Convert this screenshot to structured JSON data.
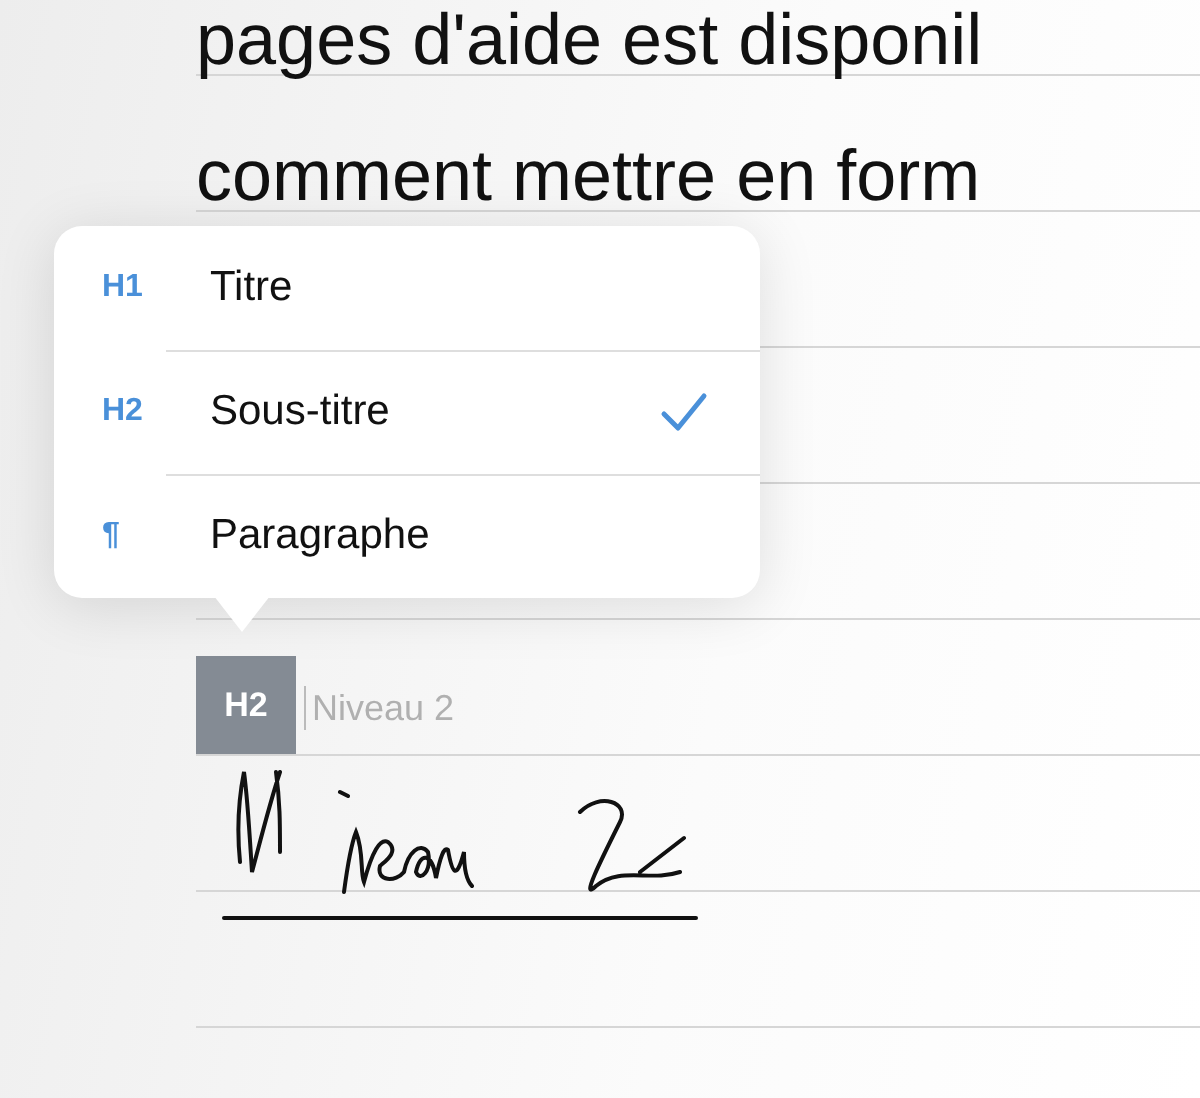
{
  "document": {
    "lines": [
      "pages d'aide est disponil",
      "comment mettre en form"
    ],
    "heading_tag": "H2",
    "heading_placeholder": "Niveau 2"
  },
  "style_menu": {
    "items": [
      {
        "icon": "H1",
        "label": "Titre",
        "selected": false
      },
      {
        "icon": "H2",
        "label": "Sous-titre",
        "selected": true
      },
      {
        "icon": "¶",
        "label": "Paragraphe",
        "selected": false
      }
    ]
  }
}
